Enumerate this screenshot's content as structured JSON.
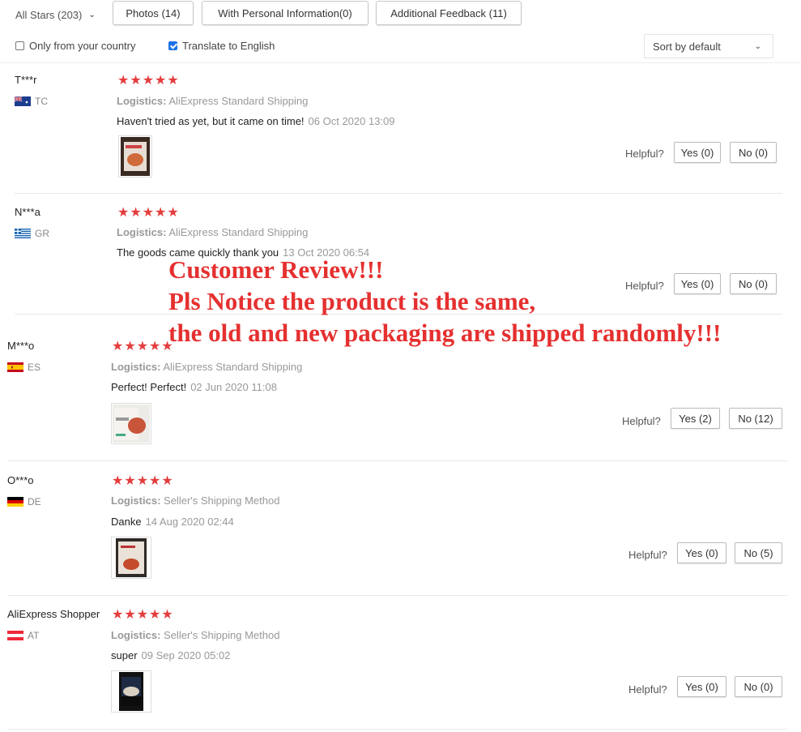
{
  "filters": {
    "stars_dropdown": "All Stars (203)",
    "photos_btn": "Photos (14)",
    "personal_btn": "With Personal Information(0)",
    "additional_btn": "Additional Feedback (11)",
    "only_country": "Only from your country",
    "translate": "Translate to English",
    "sort": "Sort by default"
  },
  "reviews": [
    {
      "user": "T***r",
      "country": "TC",
      "stars": "★★★★★",
      "logistics_label": "Logistics:",
      "logistics": "AliExpress Standard Shipping",
      "text": "Haven't tried as yet, but it came on time!",
      "date": "06 Oct 2020 13:09",
      "helpful": "Helpful?",
      "yes": "Yes (0)",
      "no": "No (0)"
    },
    {
      "user": "N***a",
      "country": "GR",
      "stars": "★★★★★",
      "logistics_label": "Logistics:",
      "logistics": "AliExpress Standard Shipping",
      "text": "The goods came quickly thank you",
      "date": "13 Oct 2020 06:54",
      "helpful": "Helpful?",
      "yes": "Yes (0)",
      "no": "No (0)"
    },
    {
      "user": "M***o",
      "country": "ES",
      "stars": "★★★★★",
      "logistics_label": "Logistics:",
      "logistics": "AliExpress Standard Shipping",
      "text": "Perfect! Perfect!",
      "date": "02 Jun 2020 11:08",
      "helpful": "Helpful?",
      "yes": "Yes (2)",
      "no": "No (12)"
    },
    {
      "user": "O***o",
      "country": "DE",
      "stars": "★★★★★",
      "logistics_label": "Logistics:",
      "logistics": "Seller's Shipping Method",
      "text": "Danke",
      "date": "14 Aug 2020 02:44",
      "helpful": "Helpful?",
      "yes": "Yes (0)",
      "no": "No (5)"
    },
    {
      "user": "AliExpress Shopper",
      "country": "AT",
      "stars": "★★★★★",
      "logistics_label": "Logistics:",
      "logistics": "Seller's Shipping Method",
      "text": "super",
      "date": "09 Sep 2020 05:02",
      "helpful": "Helpful?",
      "yes": "Yes (0)",
      "no": "No (0)"
    }
  ],
  "overlay": {
    "line1": "Customer Review!!!",
    "line2": "Pls Notice the product is the same,",
    "line3": "the old and new packaging are shipped randomly!!!"
  },
  "colors": {
    "stars": "#e43d3d",
    "overlay": "#e53030",
    "checkbox": "#1a73e8"
  }
}
